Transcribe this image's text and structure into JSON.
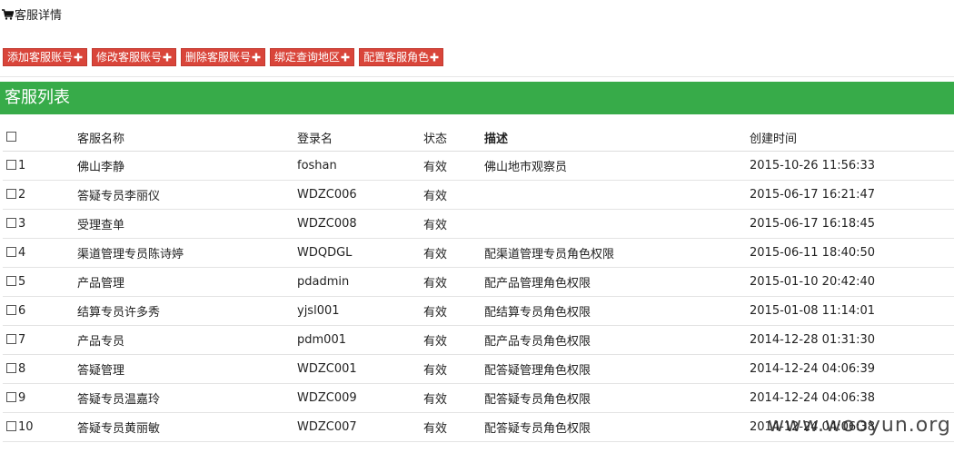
{
  "breadcrumb": {
    "icon": "cart-icon",
    "title": "客服详情"
  },
  "toolbar": {
    "accent_color": "#d9453a",
    "buttons": [
      {
        "label": "添加客服账号",
        "icon": "plus-icon"
      },
      {
        "label": "修改客服账号",
        "icon": "plus-icon"
      },
      {
        "label": "删除客服账号",
        "icon": "plus-icon"
      },
      {
        "label": "绑定查询地区",
        "icon": "plus-icon"
      },
      {
        "label": "配置客服角色",
        "icon": "plus-icon"
      }
    ]
  },
  "panel": {
    "title": "客服列表",
    "header_color": "#37ab49"
  },
  "table": {
    "columns": [
      "客服名称",
      "登录名",
      "状态",
      "描述",
      "创建时间"
    ],
    "rows": [
      {
        "index": "1",
        "name": "佛山李静",
        "login": "foshan",
        "status": "有效",
        "desc": "佛山地市观察员",
        "created": "2015-10-26 11:56:33"
      },
      {
        "index": "2",
        "name": "答疑专员李丽仪",
        "login": "WDZC006",
        "status": "有效",
        "desc": "",
        "created": "2015-06-17 16:21:47"
      },
      {
        "index": "3",
        "name": "受理查单",
        "login": "WDZC008",
        "status": "有效",
        "desc": "",
        "created": "2015-06-17 16:18:45"
      },
      {
        "index": "4",
        "name": "渠道管理专员陈诗婷",
        "login": "WDQDGL",
        "status": "有效",
        "desc": "配渠道管理专员角色权限",
        "created": "2015-06-11 18:40:50"
      },
      {
        "index": "5",
        "name": "产品管理",
        "login": "pdadmin",
        "status": "有效",
        "desc": "配产品管理角色权限",
        "created": "2015-01-10 20:42:40"
      },
      {
        "index": "6",
        "name": "结算专员许多秀",
        "login": "yjsl001",
        "status": "有效",
        "desc": "配结算专员角色权限",
        "created": "2015-01-08 11:14:01"
      },
      {
        "index": "7",
        "name": "产品专员",
        "login": "pdm001",
        "status": "有效",
        "desc": "配产品专员角色权限",
        "created": "2014-12-28 01:31:30"
      },
      {
        "index": "8",
        "name": "答疑管理",
        "login": "WDZC001",
        "status": "有效",
        "desc": "配答疑管理角色权限",
        "created": "2014-12-24 04:06:39"
      },
      {
        "index": "9",
        "name": "答疑专员温嘉玲",
        "login": "WDZC009",
        "status": "有效",
        "desc": "配答疑专员角色权限",
        "created": "2014-12-24 04:06:38"
      },
      {
        "index": "10",
        "name": "答疑专员黄丽敏",
        "login": "WDZC007",
        "status": "有效",
        "desc": "配答疑专员角色权限",
        "created": "2014-12-24 04:06:38"
      }
    ]
  },
  "watermark": "www.wooyun.org"
}
